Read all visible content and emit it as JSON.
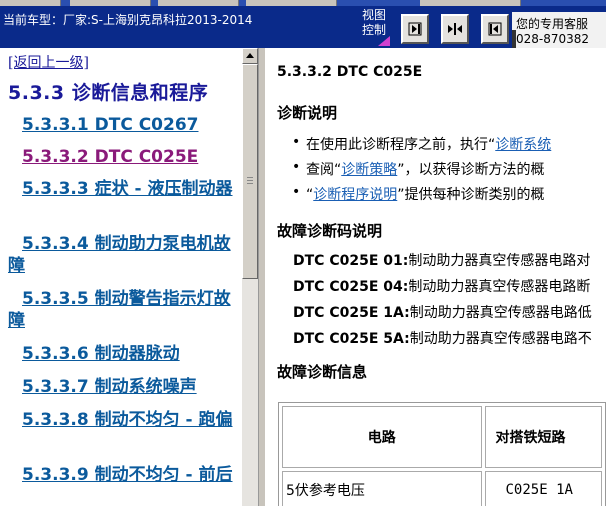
{
  "header": {
    "vehicle_label": "当前车型：厂家:S-上海别克昂科拉2013-2014",
    "view_control": [
      "视图",
      "控制"
    ],
    "nav_buttons": [
      "forward-icon",
      "collapse-icon",
      "back-icon"
    ],
    "support_line1": "您的专用客服",
    "support_line2": "028-870382"
  },
  "toc": {
    "back_link": "[返回上一级]",
    "heading": "5.3.3 诊断信息和程序",
    "items": [
      "5.3.3.1 DTC C0267",
      "5.3.3.2 DTC C025E",
      "5.3.3.3 症状 - 液压制动器",
      "5.3.3.4 制动助力泵电机故障",
      "5.3.3.5 制动警告指示灯故障",
      "5.3.3.6 制动器脉动",
      "5.3.3.7 制动系统噪声",
      "5.3.3.8 制动不均匀 - 跑偏",
      "5.3.3.9 制动不均匀 - 前后"
    ]
  },
  "doc": {
    "title": "5.3.3.2 DTC C025E",
    "diag_desc_heading": "诊断说明",
    "bullet1_pre": "在使用此诊断程序之前，执行“",
    "bullet1_link": "诊断系统",
    "bullet2_pre": "查阅“",
    "bullet2_link": "诊断策略",
    "bullet2_post": "”，以获得诊断方法的概",
    "bullet3_pre": "“",
    "bullet3_link": "诊断程序说明",
    "bullet3_post": "”提供每种诊断类别的概",
    "dtc_desc_heading": "故障诊断码说明",
    "dtcs": [
      {
        "code": "DTC C025E 01:",
        "desc": "制动助力器真空传感器电路对"
      },
      {
        "code": "DTC C025E 04:",
        "desc": "制动助力器真空传感器电路断"
      },
      {
        "code": "DTC C025E 1A:",
        "desc": "制动助力器真空传感器电路低"
      },
      {
        "code": "DTC C025E 5A:",
        "desc": "制动助力器真空传感器电路不"
      }
    ],
    "info_heading": "故障诊断信息",
    "table": {
      "headers": [
        "电路",
        "对搭铁短路"
      ],
      "rows": [
        [
          "5伏参考电压",
          "C025E 1A"
        ]
      ]
    }
  },
  "colors": {
    "header_bg": "#0a2a8a",
    "link": "#0b5a9c",
    "visited": "#8a1a7a"
  }
}
